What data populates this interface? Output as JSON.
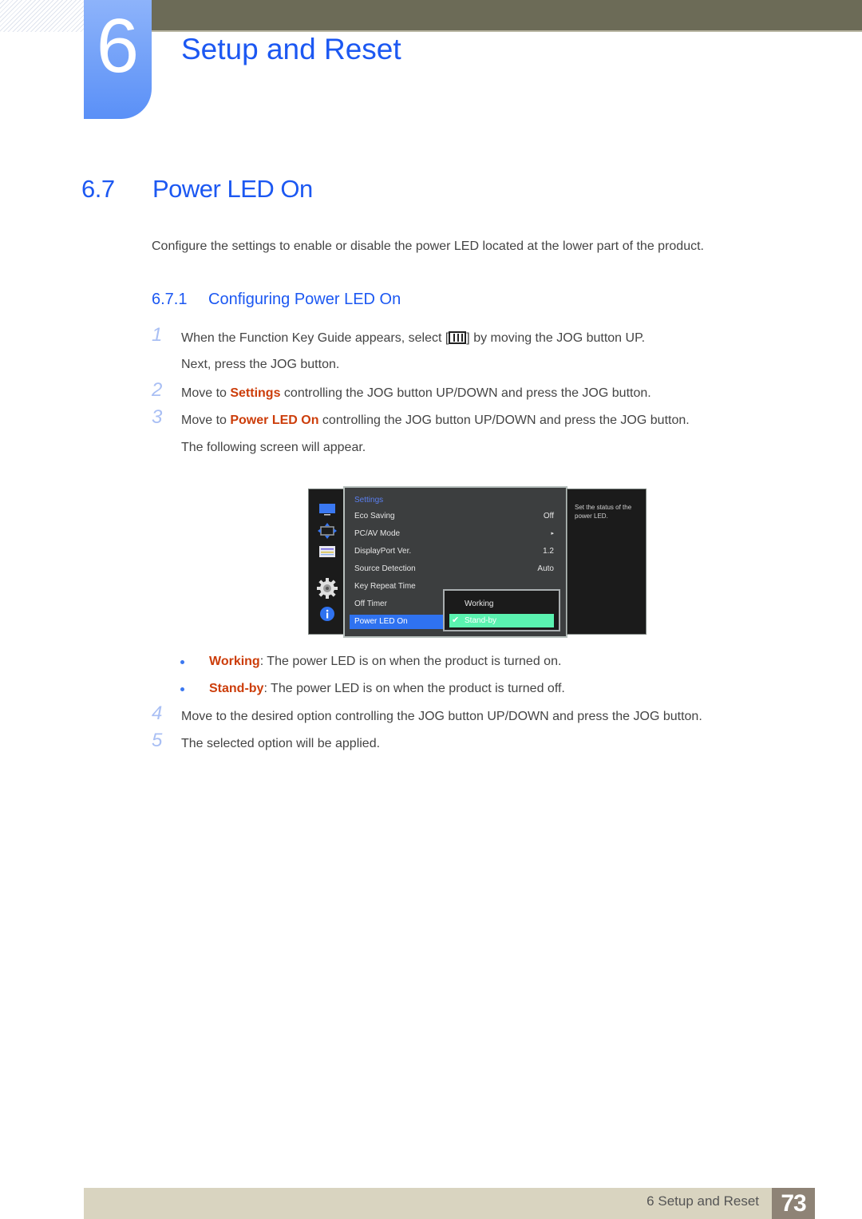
{
  "chapter": {
    "number": "6",
    "title": "Setup and Reset"
  },
  "section": {
    "number": "6.7",
    "title": "Power LED On"
  },
  "intro": "Configure the settings to enable or disable the power LED located at the lower part of the product.",
  "subsection": {
    "number": "6.7.1",
    "title": "Configuring Power LED On"
  },
  "steps": [
    {
      "n": "1",
      "line1_before": "When the Function Key Guide appears, select [",
      "icon": "menu-key-icon",
      "line1_after": "] by moving the JOG button UP.",
      "line2": "Next, press the JOG button."
    },
    {
      "n": "2",
      "before": "Move to ",
      "highlight": "Settings",
      "after": " controlling the JOG button UP/DOWN and press the JOG button."
    },
    {
      "n": "3",
      "before": "Move to ",
      "highlight": "Power LED On",
      "after": " controlling the JOG button UP/DOWN and press the JOG button.",
      "line2": "The following screen will appear."
    },
    {
      "n": "4",
      "text": "Move to the desired option controlling the JOG button UP/DOWN and press the JOG button."
    },
    {
      "n": "5",
      "text": "The selected option will be applied."
    }
  ],
  "bullets": [
    {
      "term": "Working",
      "desc": ": The power LED is on when the product is turned on."
    },
    {
      "term": "Stand-by",
      "desc": ": The power LED is on when the product is turned off."
    }
  ],
  "osd": {
    "side_icons": [
      "picture-icon",
      "screen-size-icon",
      "pip-icon",
      "settings-gear-icon",
      "info-icon"
    ],
    "menu_title": "Settings",
    "items": [
      {
        "label": "Eco Saving",
        "value": "Off"
      },
      {
        "label": "PC/AV Mode",
        "value": "▸"
      },
      {
        "label": "DisplayPort Ver.",
        "value": "1.2"
      },
      {
        "label": "Source Detection",
        "value": "Auto"
      },
      {
        "label": "Key Repeat Time",
        "value": ""
      },
      {
        "label": "Off Timer",
        "value": ""
      },
      {
        "label": "Power LED On",
        "value": ""
      }
    ],
    "selected_item": "Power LED On",
    "options": [
      {
        "label": "Working",
        "selected": false
      },
      {
        "label": "Stand-by",
        "selected": true
      }
    ],
    "check_glyph": "✔",
    "help_text": "Set the status of the power LED."
  },
  "footer": {
    "text": "6 Setup and Reset",
    "page": "73"
  },
  "colors": {
    "accent_blue": "#1c58f2",
    "highlight_orange": "#cc3d0a",
    "osd_selected": "#2f72f0",
    "osd_option_selected": "#5af3b0"
  }
}
